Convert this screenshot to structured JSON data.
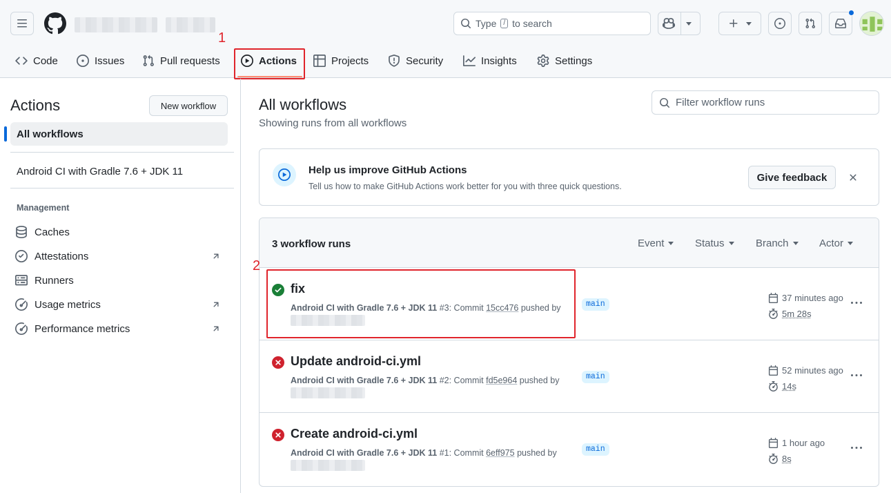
{
  "header": {
    "search_prefix": "Type",
    "search_key": "/",
    "search_suffix": "to search"
  },
  "tabs": [
    {
      "label": "Code",
      "icon": "code-icon"
    },
    {
      "label": "Issues",
      "icon": "issue-opened-icon"
    },
    {
      "label": "Pull requests",
      "icon": "git-pull-request-icon"
    },
    {
      "label": "Actions",
      "icon": "play-icon",
      "active": true
    },
    {
      "label": "Projects",
      "icon": "table-icon"
    },
    {
      "label": "Security",
      "icon": "shield-icon"
    },
    {
      "label": "Insights",
      "icon": "graph-icon"
    },
    {
      "label": "Settings",
      "icon": "gear-icon"
    }
  ],
  "annotations": {
    "tab": "1",
    "run": "2",
    "color": "#e0242b"
  },
  "sidebar": {
    "title": "Actions",
    "new_workflow": "New workflow",
    "all_workflows": "All workflows",
    "workflow": "Android CI with Gradle 7.6 + JDK 11",
    "management_heading": "Management",
    "management": [
      {
        "label": "Caches",
        "icon": "database-icon",
        "external": false
      },
      {
        "label": "Attestations",
        "icon": "verified-icon",
        "external": true
      },
      {
        "label": "Runners",
        "icon": "server-icon",
        "external": false
      },
      {
        "label": "Usage metrics",
        "icon": "meter-icon",
        "external": true
      },
      {
        "label": "Performance metrics",
        "icon": "meter-icon",
        "external": true
      }
    ]
  },
  "main": {
    "title": "All workflows",
    "subtitle": "Showing runs from all workflows",
    "filter_placeholder": "Filter workflow runs",
    "banner": {
      "title": "Help us improve GitHub Actions",
      "text": "Tell us how to make GitHub Actions work better for you with three quick questions.",
      "button": "Give feedback"
    },
    "runs_count": "3 workflow runs",
    "filters": [
      "Event",
      "Status",
      "Branch",
      "Actor"
    ],
    "runs": [
      {
        "title": "fix",
        "status": "success",
        "workflow": "Android CI with Gradle 7.6 + JDK 11",
        "run_no": "#3: Commit",
        "sha": "15cc476",
        "pushed": "pushed by",
        "branch": "main",
        "time": "37 minutes ago",
        "duration": "5m 28s"
      },
      {
        "title": "Update android-ci.yml",
        "status": "failure",
        "workflow": "Android CI with Gradle 7.6 + JDK 11",
        "run_no": "#2: Commit",
        "sha": "fd5e964",
        "pushed": "pushed by",
        "branch": "main",
        "time": "52 minutes ago",
        "duration": "14s"
      },
      {
        "title": "Create android-ci.yml",
        "status": "failure",
        "workflow": "Android CI with Gradle 7.6 + JDK 11",
        "run_no": "#1: Commit",
        "sha": "6eff975",
        "pushed": "pushed by",
        "branch": "main",
        "time": "1 hour ago",
        "duration": "8s"
      }
    ]
  },
  "colors": {
    "success": "#1a7f37",
    "failure": "#cf222e",
    "accent": "#0969da",
    "tab_underline": "#fd8c73"
  }
}
